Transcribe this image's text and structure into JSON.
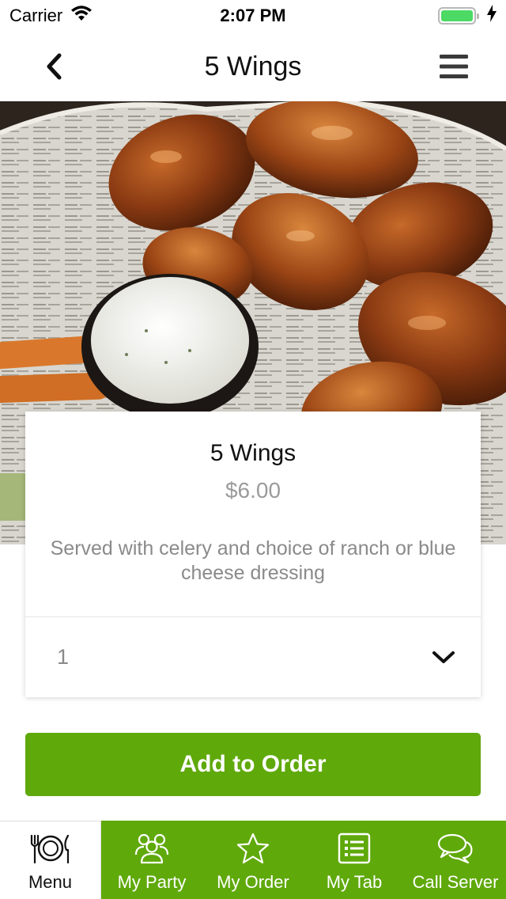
{
  "status_bar": {
    "carrier": "Carrier",
    "time": "2:07 PM",
    "battery_level": 1.0
  },
  "nav": {
    "title": "5 Wings",
    "back_icon": "chevron-left-icon",
    "menu_icon": "hamburger-menu-icon"
  },
  "item": {
    "name": "5 Wings",
    "price": "$6.00",
    "description": "Served with celery and choice of ranch or blue cheese dressing",
    "quantity": "1"
  },
  "actions": {
    "add_label": "Add to Order"
  },
  "tabs": [
    {
      "label": "Menu",
      "icon": "menu-plate-icon",
      "active": true
    },
    {
      "label": "My Party",
      "icon": "party-people-icon",
      "active": false
    },
    {
      "label": "My Order",
      "icon": "star-icon",
      "active": false
    },
    {
      "label": "My Tab",
      "icon": "list-icon",
      "active": false
    },
    {
      "label": "Call Server",
      "icon": "chat-bubbles-icon",
      "active": false
    }
  ],
  "colors": {
    "accent": "#5fa90b",
    "battery": "#4cd964"
  }
}
